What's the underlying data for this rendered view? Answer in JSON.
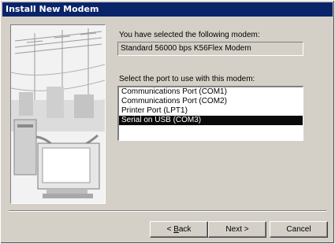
{
  "window": {
    "title": "Install New Modem"
  },
  "selected_modem": {
    "label": "You have selected the following modem:",
    "value": "Standard 56000 bps K56Flex Modem"
  },
  "port": {
    "label": "Select the port to use with this modem:",
    "items": [
      "Communications Port (COM1)",
      "Communications Port (COM2)",
      "Printer Port (LPT1)",
      "Serial on USB (COM3)"
    ],
    "selected_index": 3
  },
  "buttons": {
    "back_mnemonic": "B",
    "back_rest": "ack",
    "back_prefix": "< ",
    "next_label": "Next >",
    "cancel_label": "Cancel"
  },
  "illustration": {
    "icon": "modem-computer-illustration"
  }
}
